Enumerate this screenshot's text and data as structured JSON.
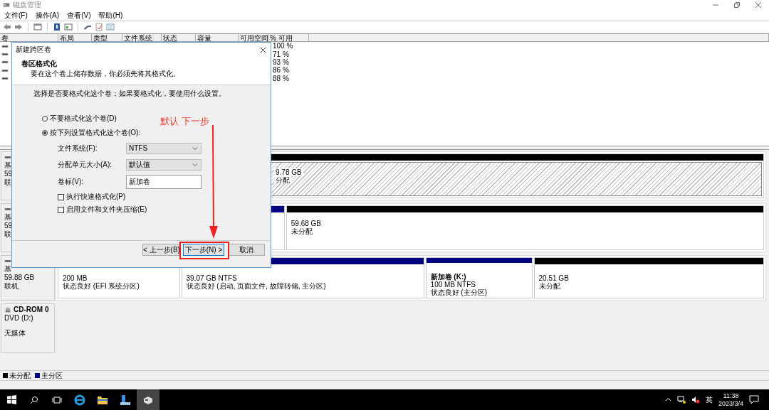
{
  "window": {
    "title": "磁盘管理"
  },
  "menu": [
    {
      "label": "文件(F)"
    },
    {
      "label": "操作(A)"
    },
    {
      "label": "查看(V)"
    },
    {
      "label": "帮助(H)"
    }
  ],
  "volume_table": {
    "columns": [
      "卷",
      "布局",
      "类型",
      "文件系统",
      "状态",
      "容量",
      "可用空间",
      "% 可用"
    ],
    "rows": [
      {
        "percent_free": "100 %"
      },
      {
        "percent_free": "71 %"
      },
      {
        "percent_free": "93 %"
      },
      {
        "percent_free": "86 %"
      },
      {
        "percent_free": "88 %"
      }
    ]
  },
  "disks": [
    {
      "label_lines": [
        "基",
        "59",
        "联"
      ],
      "partitions": [
        {
          "kind": "unallocated",
          "selected": true,
          "lines": [
            "9.78 GB",
            "分配"
          ]
        }
      ]
    },
    {
      "label_lines": [
        "基",
        "59",
        "联"
      ],
      "partitions": [
        {
          "kind": "primary",
          "selected": false
        },
        {
          "kind": "unallocated",
          "selected": false,
          "lines": [
            "59.68 GB",
            "未分配"
          ]
        }
      ]
    },
    {
      "label_lines": [
        "基",
        "59.88 GB",
        "联机"
      ],
      "partitions": [
        {
          "kind": "primary",
          "selected": false,
          "lines": [
            "200 MB",
            "状态良好 (EFI 系统分区)"
          ]
        },
        {
          "kind": "primary",
          "selected": false,
          "lines": [
            "39.07 GB NTFS",
            "状态良好 (启动, 页面文件, 故障转储, 主分区)"
          ]
        },
        {
          "kind": "primary",
          "selected": false,
          "name": "新加卷  (K:)",
          "lines": [
            "100 MB NTFS",
            "状态良好 (主分区)"
          ]
        },
        {
          "kind": "unallocated",
          "selected": false,
          "lines": [
            "20.51 GB",
            "未分配"
          ]
        }
      ]
    }
  ],
  "cdrom": {
    "name": "CD-ROM 0",
    "lines": [
      "DVD (D:)",
      "无媒体"
    ]
  },
  "legend": [
    {
      "label": "未分配",
      "color": "#000000"
    },
    {
      "label": "主分区",
      "color": "#000080"
    }
  ],
  "dialog": {
    "title": "新建跨区卷",
    "heading": "卷区格式化",
    "subheading": "要在这个卷上储存数据，你必须先将其格式化。",
    "prompt": "选择是否要格式化这个卷；如果要格式化，要使用什么设置。",
    "options": [
      {
        "label": "不要格式化这个卷(D)",
        "selected": false
      },
      {
        "label": "按下列设置格式化这个卷(O):",
        "selected": true
      }
    ],
    "fields": [
      {
        "kind": "select",
        "label": "文件系统(F):",
        "value": "NTFS"
      },
      {
        "kind": "select",
        "label": "分配单元大小(A):",
        "value": "默认值"
      },
      {
        "kind": "text",
        "label": "卷标(V):",
        "value": "新加卷"
      }
    ],
    "checkboxes": [
      {
        "label": "执行快速格式化(P)",
        "checked": false
      },
      {
        "label": "启用文件和文件夹压缩(E)",
        "checked": false
      }
    ],
    "buttons": [
      {
        "label": "< 上一步(B)",
        "focused": false
      },
      {
        "label": "下一步(N) >",
        "focused": true
      },
      {
        "label": "取消",
        "focused": false
      }
    ]
  },
  "annotation": {
    "text": "默认 下一步"
  },
  "taskbar": {
    "ime": "英",
    "time": "11:38",
    "date": "2023/3/4"
  }
}
